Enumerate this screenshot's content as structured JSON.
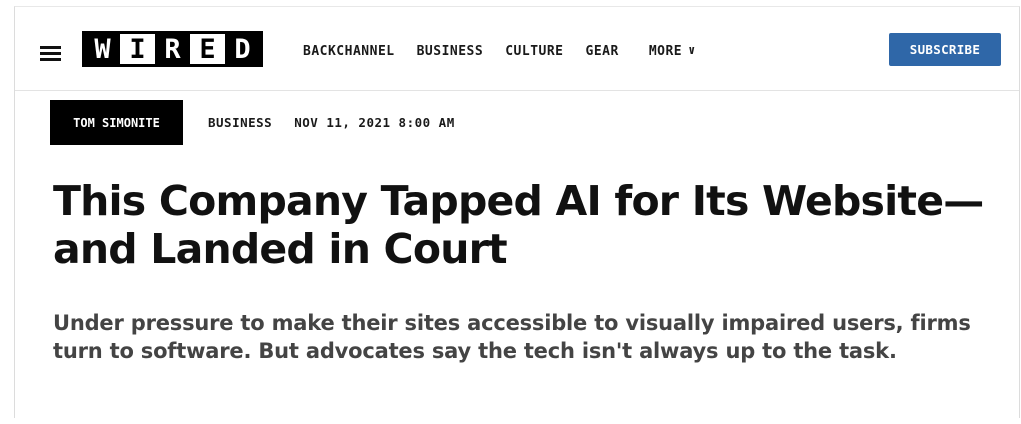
{
  "header": {
    "logo": [
      "W",
      "I",
      "R",
      "E",
      "D"
    ],
    "nav": {
      "items": [
        "BACKCHANNEL",
        "BUSINESS",
        "CULTURE",
        "GEAR"
      ],
      "more_label": "MORE"
    },
    "subscribe_label": "SUBSCRIBE"
  },
  "article": {
    "author": "TOM SIMONITE",
    "category": "BUSINESS",
    "date": "NOV 11, 2021 8:00 AM",
    "headline": "This Company Tapped AI for Its Website—and Landed in Court",
    "dek": "Under pressure to make their sites accessible to visually impaired users, firms turn to software. But advocates say the tech isn't always up to the task."
  },
  "colors": {
    "subscribe_bg": "#2f67a8",
    "author_bg": "#000000",
    "headline": "#111111",
    "dek": "#444444"
  },
  "icons": {
    "menu": "hamburger-menu-icon",
    "more": "chevron-down-icon"
  }
}
